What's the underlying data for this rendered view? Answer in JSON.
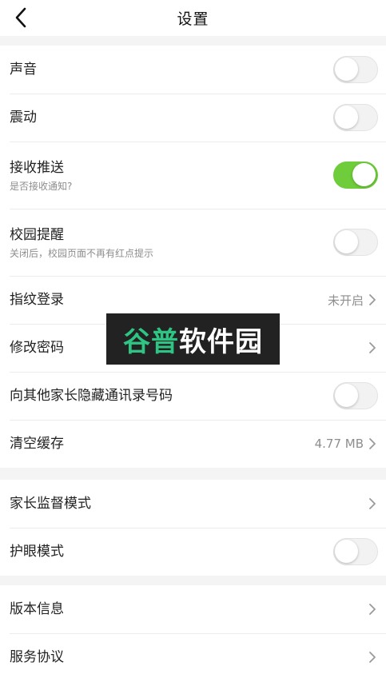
{
  "header": {
    "title": "设置",
    "back_icon": "chevron-left-icon"
  },
  "colors": {
    "accent": "#6fcc3b",
    "watermark_green": "#2ec483"
  },
  "settings": {
    "sound": {
      "label": "声音",
      "enabled": false
    },
    "vibration": {
      "label": "震动",
      "enabled": false
    },
    "push": {
      "label": "接收推送",
      "subtitle": "是否接收通知?",
      "enabled": true
    },
    "campus_reminder": {
      "label": "校园提醒",
      "subtitle": "关闭后，校园页面不再有红点提示",
      "enabled": false
    },
    "fingerprint": {
      "label": "指纹登录",
      "value": "未开启"
    },
    "change_password": {
      "label": "修改密码"
    },
    "hide_contacts": {
      "label": "向其他家长隐藏通讯录号码",
      "enabled": false
    },
    "clear_cache": {
      "label": "清空缓存",
      "value": "4.77 MB"
    }
  },
  "settings2": {
    "parental_mode": {
      "label": "家长监督模式"
    },
    "eye_mode": {
      "label": "护眼模式",
      "enabled": false
    }
  },
  "settings3": {
    "version": {
      "label": "版本信息"
    },
    "service": {
      "label": "服务协议"
    }
  },
  "watermark": {
    "part1": "谷普",
    "part2": "软件园"
  }
}
